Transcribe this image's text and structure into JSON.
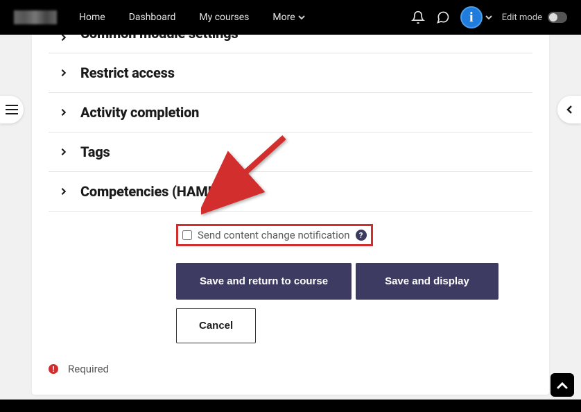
{
  "nav": {
    "home": "Home",
    "dashboard": "Dashboard",
    "my_courses": "My courses",
    "more": "More",
    "edit_mode": "Edit mode"
  },
  "sections": {
    "partial": "Common module settings",
    "restrict_access": "Restrict access",
    "activity_completion": "Activity completion",
    "tags": "Tags",
    "competencies": "Competencies (HAMI)"
  },
  "form": {
    "notify_label": "Send content change notification",
    "save_return": "Save and return to course",
    "save_display": "Save and display",
    "cancel": "Cancel",
    "required": "Required"
  }
}
